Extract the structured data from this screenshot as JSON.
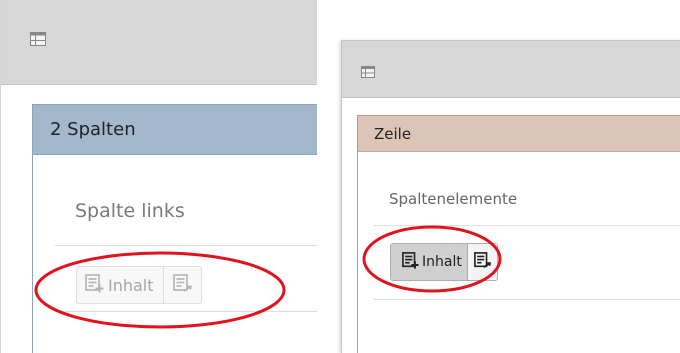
{
  "left_panel": {
    "header_icon": "layout-table-icon",
    "grid_title": "2 Spalten",
    "column_label": "Spalte links",
    "add_content_label": "Inhalt",
    "add_icon": "new-content-icon",
    "paste_icon": "paste-reference-icon",
    "state": "disabled"
  },
  "right_panel": {
    "header_icon": "layout-table-icon",
    "grid_title": "Zeile",
    "column_label": "Spaltenelemente",
    "add_content_label": "Inhalt",
    "add_icon": "new-content-icon",
    "paste_icon": "paste-reference-icon",
    "state": "active"
  },
  "colors": {
    "header_gray": "#d7d7d7",
    "left_title_blue": "#a3b8cc",
    "right_title_tan": "#dcc4b6",
    "annotation_red": "#e0141e"
  }
}
